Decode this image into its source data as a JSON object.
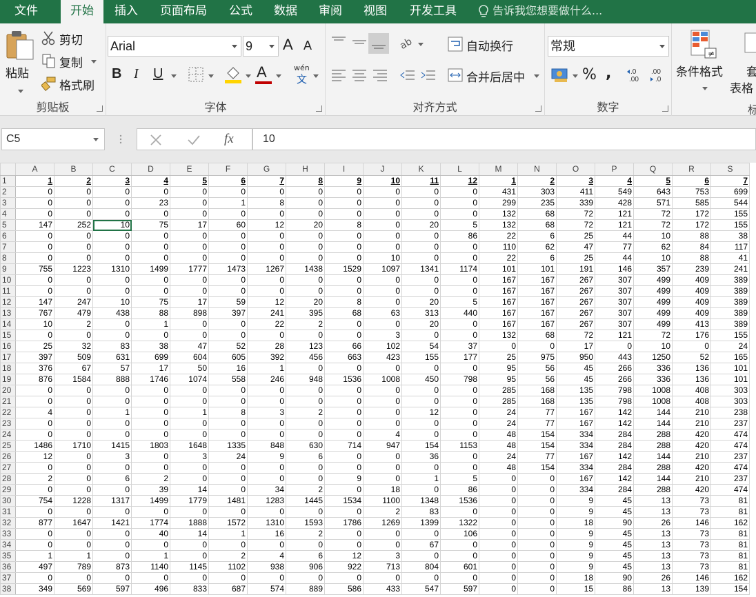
{
  "menu": {
    "tabs": [
      "文件",
      "开始",
      "插入",
      "页面布局",
      "公式",
      "数据",
      "审阅",
      "视图",
      "开发工具"
    ],
    "active_tab": "开始",
    "tell_me": "告诉我您想要做什么..."
  },
  "ribbon": {
    "clipboard": {
      "paste": "粘贴",
      "cut": "剪切",
      "copy": "复制",
      "format_painter": "格式刷",
      "label": "剪贴板"
    },
    "font": {
      "name": "Arial",
      "size": "9",
      "label": "字体",
      "bold": "B",
      "italic": "I",
      "underline": "U",
      "font_color_glyph": "A",
      "grow": "A",
      "shrink": "A",
      "wen_top": "wén",
      "wen_bottom": "文"
    },
    "alignment": {
      "wrap": "自动换行",
      "merge": "合并后居中",
      "label": "对齐方式"
    },
    "number": {
      "format": "常规",
      "label": "数字",
      "percent": "%",
      "comma": ",",
      "inc_dec": "←.0 .00",
      "dec_dec": ".00 →.0"
    },
    "styles": {
      "conditional": "条件格式",
      "table_partial": "套",
      "table_partial2": "表格",
      "label_partial": "标"
    }
  },
  "formula_bar": {
    "name_box": "C5",
    "fx": "fx",
    "value": "10"
  },
  "grid": {
    "columns": [
      "A",
      "B",
      "C",
      "D",
      "E",
      "F",
      "G",
      "H",
      "I",
      "J",
      "K",
      "L",
      "M",
      "N",
      "O",
      "P",
      "Q",
      "R",
      "S"
    ],
    "selected_cell": "C5",
    "rows": [
      [
        "1",
        "2",
        "3",
        "4",
        "5",
        "6",
        "7",
        "8",
        "9",
        "10",
        "11",
        "12",
        "1",
        "2",
        "3",
        "4",
        "5",
        "6",
        "7"
      ],
      [
        "0",
        "0",
        "0",
        "0",
        "0",
        "0",
        "0",
        "0",
        "0",
        "0",
        "0",
        "0",
        "431",
        "303",
        "411",
        "549",
        "643",
        "753",
        "699"
      ],
      [
        "0",
        "0",
        "0",
        "23",
        "0",
        "1",
        "8",
        "0",
        "0",
        "0",
        "0",
        "0",
        "299",
        "235",
        "339",
        "428",
        "571",
        "585",
        "544"
      ],
      [
        "0",
        "0",
        "0",
        "0",
        "0",
        "0",
        "0",
        "0",
        "0",
        "0",
        "0",
        "0",
        "132",
        "68",
        "72",
        "121",
        "72",
        "172",
        "155"
      ],
      [
        "147",
        "252",
        "10",
        "75",
        "17",
        "60",
        "12",
        "20",
        "8",
        "0",
        "20",
        "5",
        "132",
        "68",
        "72",
        "121",
        "72",
        "172",
        "155"
      ],
      [
        "0",
        "0",
        "0",
        "0",
        "0",
        "0",
        "0",
        "0",
        "0",
        "0",
        "0",
        "86",
        "22",
        "6",
        "25",
        "44",
        "10",
        "88",
        "38"
      ],
      [
        "0",
        "0",
        "0",
        "0",
        "0",
        "0",
        "0",
        "0",
        "0",
        "0",
        "0",
        "0",
        "110",
        "62",
        "47",
        "77",
        "62",
        "84",
        "117"
      ],
      [
        "0",
        "0",
        "0",
        "0",
        "0",
        "0",
        "0",
        "0",
        "0",
        "10",
        "0",
        "0",
        "22",
        "6",
        "25",
        "44",
        "10",
        "88",
        "41"
      ],
      [
        "755",
        "1223",
        "1310",
        "1499",
        "1777",
        "1473",
        "1267",
        "1438",
        "1529",
        "1097",
        "1341",
        "1174",
        "101",
        "101",
        "191",
        "146",
        "357",
        "239",
        "241"
      ],
      [
        "0",
        "0",
        "0",
        "0",
        "0",
        "0",
        "0",
        "0",
        "0",
        "0",
        "0",
        "0",
        "167",
        "167",
        "267",
        "307",
        "499",
        "409",
        "389"
      ],
      [
        "0",
        "0",
        "0",
        "0",
        "0",
        "0",
        "0",
        "0",
        "0",
        "0",
        "0",
        "0",
        "167",
        "167",
        "267",
        "307",
        "499",
        "409",
        "389"
      ],
      [
        "147",
        "247",
        "10",
        "75",
        "17",
        "59",
        "12",
        "20",
        "8",
        "0",
        "20",
        "5",
        "167",
        "167",
        "267",
        "307",
        "499",
        "409",
        "389"
      ],
      [
        "767",
        "479",
        "438",
        "88",
        "898",
        "397",
        "241",
        "395",
        "68",
        "63",
        "313",
        "440",
        "167",
        "167",
        "267",
        "307",
        "499",
        "409",
        "389"
      ],
      [
        "10",
        "2",
        "0",
        "1",
        "0",
        "0",
        "22",
        "2",
        "0",
        "0",
        "20",
        "0",
        "167",
        "167",
        "267",
        "307",
        "499",
        "413",
        "389"
      ],
      [
        "0",
        "0",
        "0",
        "0",
        "0",
        "0",
        "0",
        "0",
        "0",
        "3",
        "0",
        "0",
        "132",
        "68",
        "72",
        "121",
        "72",
        "176",
        "155"
      ],
      [
        "25",
        "32",
        "83",
        "38",
        "47",
        "52",
        "28",
        "123",
        "66",
        "102",
        "54",
        "37",
        "0",
        "0",
        "17",
        "0",
        "10",
        "0",
        "24"
      ],
      [
        "397",
        "509",
        "631",
        "699",
        "604",
        "605",
        "392",
        "456",
        "663",
        "423",
        "155",
        "177",
        "25",
        "975",
        "950",
        "443",
        "1250",
        "52",
        "165"
      ],
      [
        "376",
        "67",
        "57",
        "17",
        "50",
        "16",
        "1",
        "0",
        "0",
        "0",
        "0",
        "0",
        "95",
        "56",
        "45",
        "266",
        "336",
        "136",
        "101"
      ],
      [
        "876",
        "1584",
        "888",
        "1746",
        "1074",
        "558",
        "246",
        "948",
        "1536",
        "1008",
        "450",
        "798",
        "95",
        "56",
        "45",
        "266",
        "336",
        "136",
        "101"
      ],
      [
        "0",
        "0",
        "0",
        "0",
        "0",
        "0",
        "0",
        "0",
        "0",
        "0",
        "0",
        "0",
        "285",
        "168",
        "135",
        "798",
        "1008",
        "408",
        "303"
      ],
      [
        "0",
        "0",
        "0",
        "0",
        "0",
        "0",
        "0",
        "0",
        "0",
        "0",
        "0",
        "0",
        "285",
        "168",
        "135",
        "798",
        "1008",
        "408",
        "303"
      ],
      [
        "4",
        "0",
        "1",
        "0",
        "1",
        "8",
        "3",
        "2",
        "0",
        "0",
        "12",
        "0",
        "24",
        "77",
        "167",
        "142",
        "144",
        "210",
        "238"
      ],
      [
        "0",
        "0",
        "0",
        "0",
        "0",
        "0",
        "0",
        "0",
        "0",
        "0",
        "0",
        "0",
        "24",
        "77",
        "167",
        "142",
        "144",
        "210",
        "237"
      ],
      [
        "0",
        "0",
        "0",
        "0",
        "0",
        "0",
        "0",
        "0",
        "0",
        "4",
        "0",
        "0",
        "48",
        "154",
        "334",
        "284",
        "288",
        "420",
        "474"
      ],
      [
        "1486",
        "1710",
        "1415",
        "1803",
        "1648",
        "1335",
        "848",
        "630",
        "714",
        "947",
        "154",
        "1153",
        "48",
        "154",
        "334",
        "284",
        "288",
        "420",
        "474"
      ],
      [
        "12",
        "0",
        "3",
        "0",
        "3",
        "24",
        "9",
        "6",
        "0",
        "0",
        "36",
        "0",
        "24",
        "77",
        "167",
        "142",
        "144",
        "210",
        "237"
      ],
      [
        "0",
        "0",
        "0",
        "0",
        "0",
        "0",
        "0",
        "0",
        "0",
        "0",
        "0",
        "0",
        "48",
        "154",
        "334",
        "284",
        "288",
        "420",
        "474"
      ],
      [
        "2",
        "0",
        "6",
        "2",
        "0",
        "0",
        "0",
        "0",
        "9",
        "0",
        "1",
        "5",
        "0",
        "0",
        "167",
        "142",
        "144",
        "210",
        "237"
      ],
      [
        "0",
        "0",
        "0",
        "39",
        "14",
        "0",
        "34",
        "2",
        "0",
        "18",
        "0",
        "86",
        "0",
        "0",
        "334",
        "284",
        "288",
        "420",
        "474"
      ],
      [
        "754",
        "1228",
        "1317",
        "1499",
        "1779",
        "1481",
        "1283",
        "1445",
        "1534",
        "1100",
        "1348",
        "1536",
        "0",
        "0",
        "9",
        "45",
        "13",
        "73",
        "81"
      ],
      [
        "0",
        "0",
        "0",
        "0",
        "0",
        "0",
        "0",
        "0",
        "0",
        "2",
        "83",
        "0",
        "0",
        "0",
        "9",
        "45",
        "13",
        "73",
        "81"
      ],
      [
        "877",
        "1647",
        "1421",
        "1774",
        "1888",
        "1572",
        "1310",
        "1593",
        "1786",
        "1269",
        "1399",
        "1322",
        "0",
        "0",
        "18",
        "90",
        "26",
        "146",
        "162"
      ],
      [
        "0",
        "0",
        "0",
        "40",
        "14",
        "1",
        "16",
        "2",
        "0",
        "0",
        "0",
        "106",
        "0",
        "0",
        "9",
        "45",
        "13",
        "73",
        "81"
      ],
      [
        "0",
        "0",
        "0",
        "0",
        "0",
        "0",
        "0",
        "0",
        "0",
        "0",
        "67",
        "0",
        "0",
        "0",
        "9",
        "45",
        "13",
        "73",
        "81"
      ],
      [
        "1",
        "1",
        "0",
        "1",
        "0",
        "2",
        "4",
        "6",
        "12",
        "3",
        "0",
        "0",
        "0",
        "0",
        "9",
        "45",
        "13",
        "73",
        "81"
      ],
      [
        "497",
        "789",
        "873",
        "1140",
        "1145",
        "1102",
        "938",
        "906",
        "922",
        "713",
        "804",
        "601",
        "0",
        "0",
        "9",
        "45",
        "13",
        "73",
        "81"
      ],
      [
        "0",
        "0",
        "0",
        "0",
        "0",
        "0",
        "0",
        "0",
        "0",
        "0",
        "0",
        "0",
        "0",
        "0",
        "18",
        "90",
        "26",
        "146",
        "162"
      ],
      [
        "349",
        "569",
        "597",
        "496",
        "833",
        "687",
        "574",
        "889",
        "586",
        "433",
        "547",
        "597",
        "0",
        "0",
        "15",
        "86",
        "13",
        "139",
        "154"
      ]
    ]
  }
}
